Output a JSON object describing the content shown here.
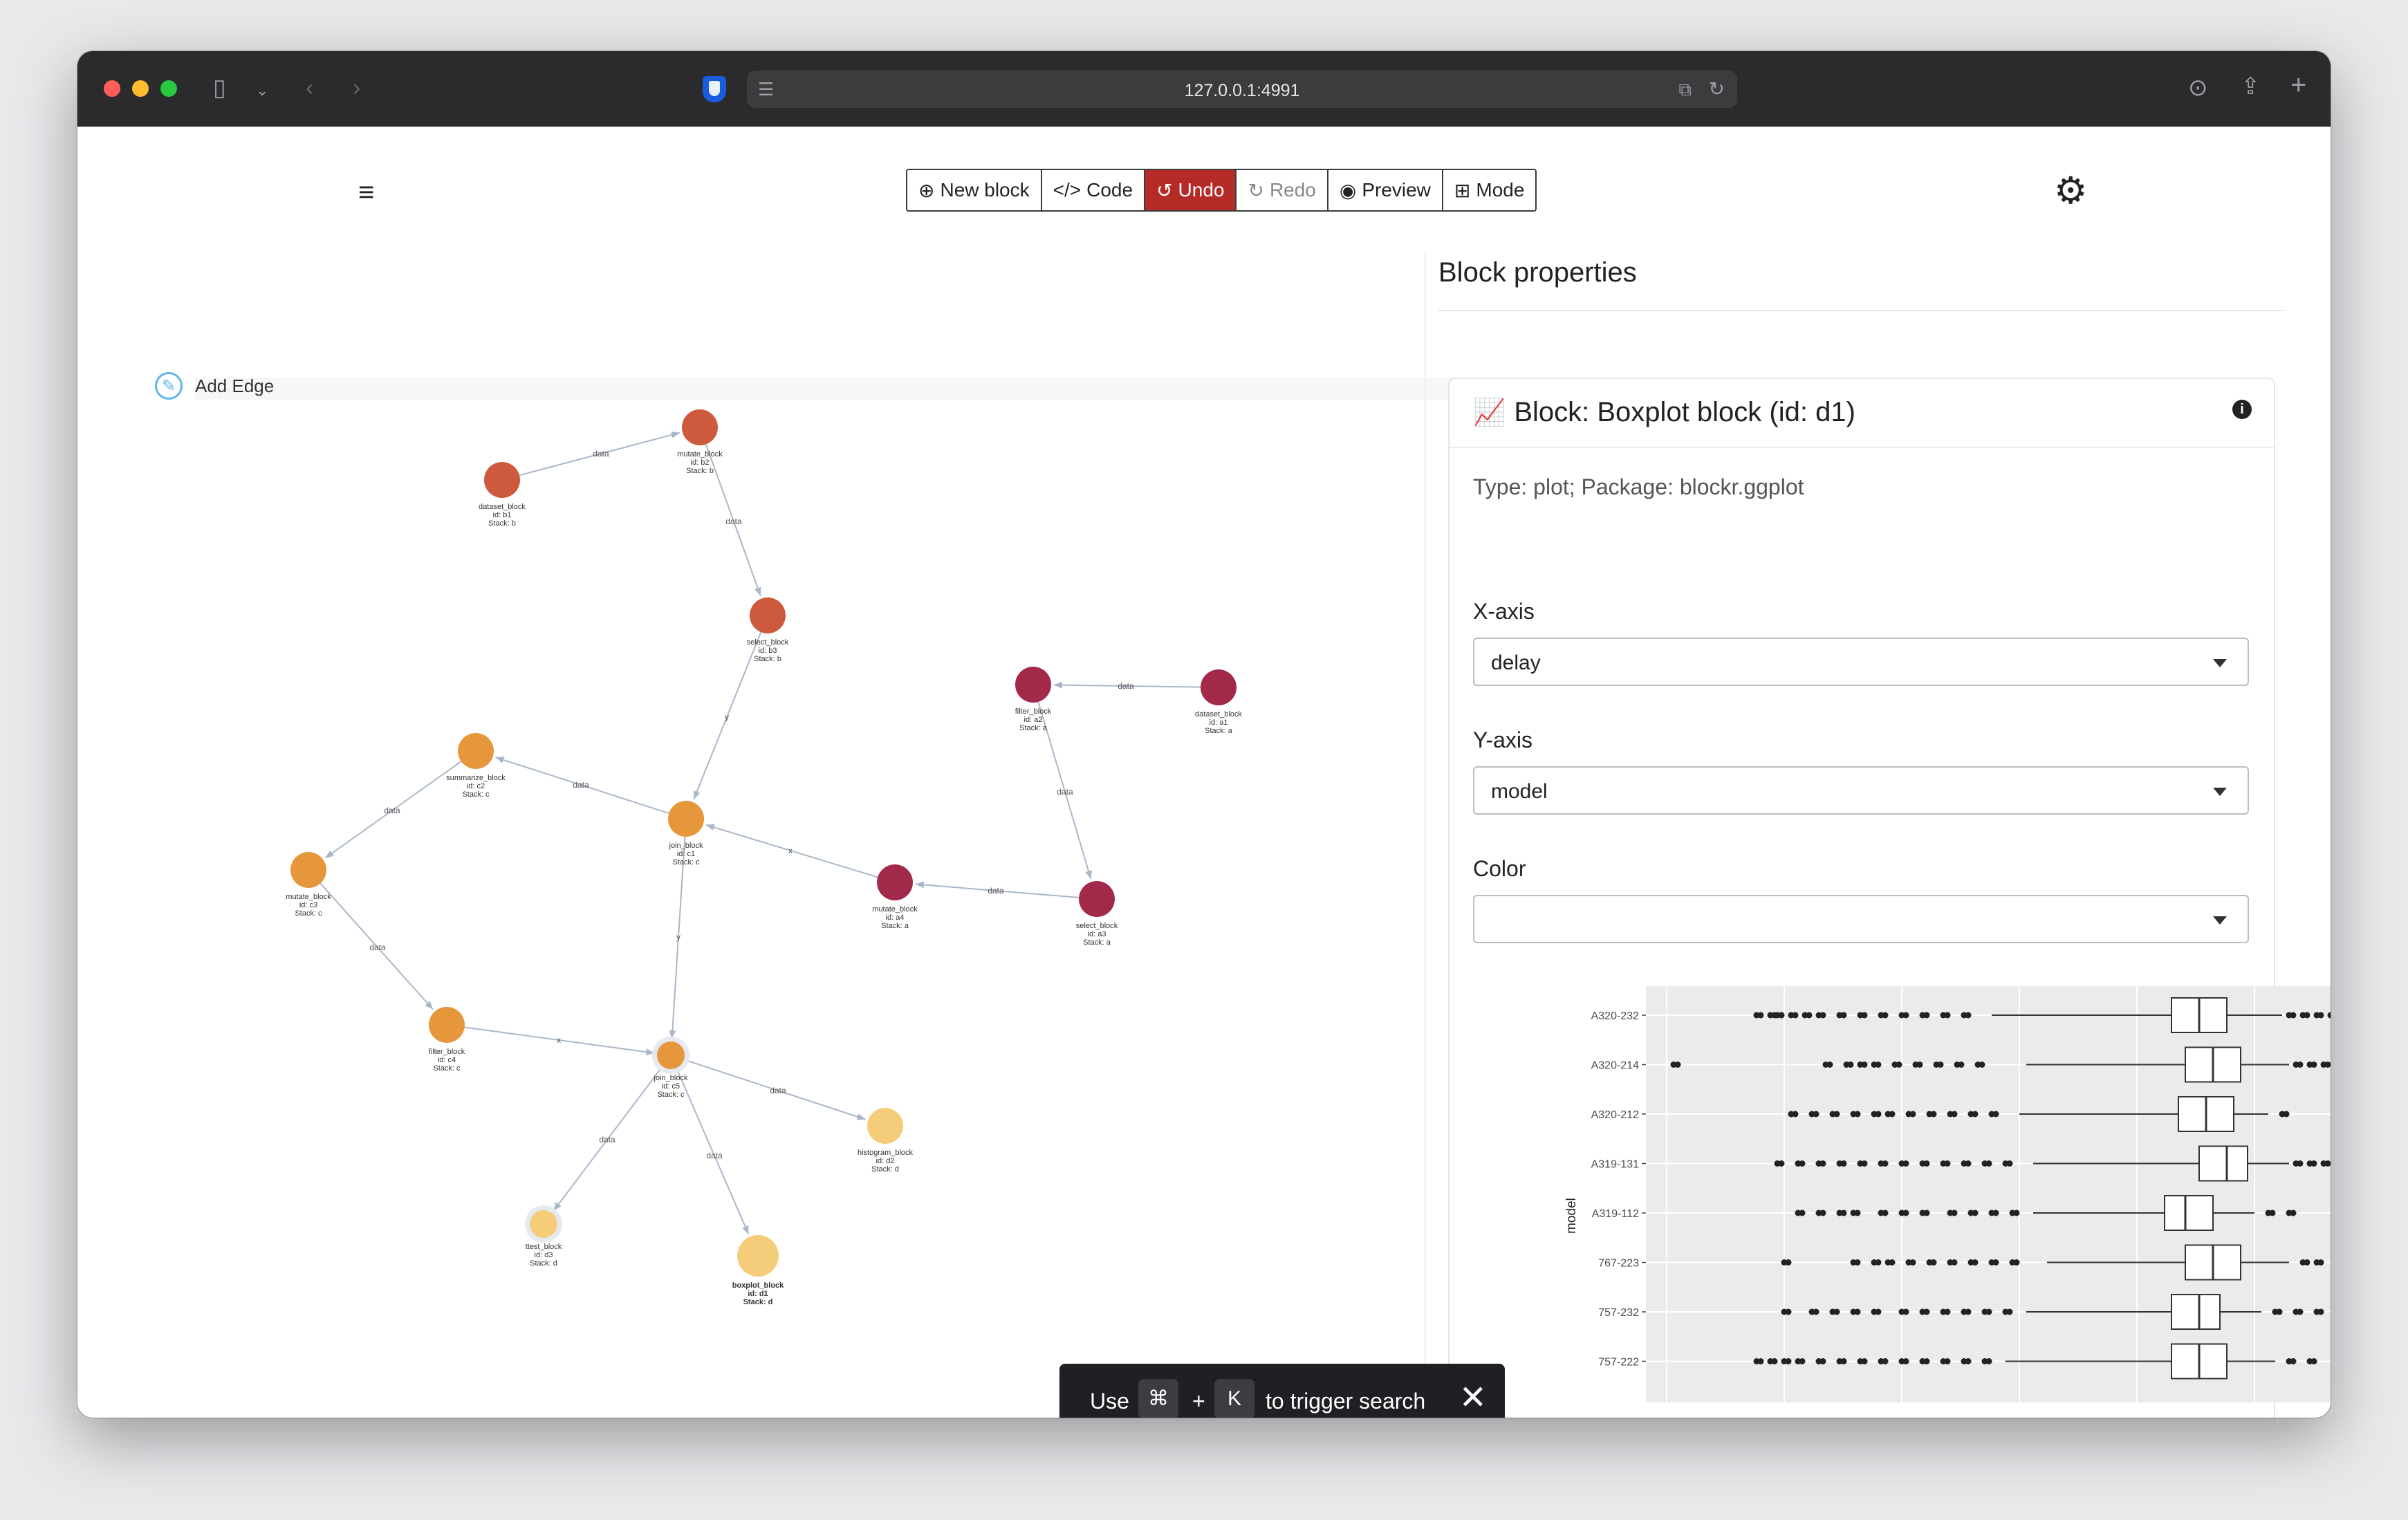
{
  "browser": {
    "url": "127.0.0.1:4991"
  },
  "toolbar": {
    "new_block": "New block",
    "code": "Code",
    "undo": "Undo",
    "redo": "Redo",
    "preview": "Preview",
    "mode": "Mode"
  },
  "graph": {
    "add_edge": "Add Edge",
    "colors": {
      "stack_a": "#a3294a",
      "stack_b": "#cd5a3c",
      "stack_c": "#e6963b",
      "stack_d": "#f5cd7a",
      "edge": "#a9b7c9"
    },
    "nodes": [
      {
        "type": "dataset_block",
        "id": "id: b1",
        "stack": "Stack: b"
      },
      {
        "type": "mutate_block",
        "id": "id: b2",
        "stack": "Stack: b"
      },
      {
        "type": "select_block",
        "id": "id: b3",
        "stack": "Stack: b"
      },
      {
        "type": "filter_block",
        "id": "id: a2",
        "stack": "Stack: a"
      },
      {
        "type": "dataset_block",
        "id": "id: a1",
        "stack": "Stack: a"
      },
      {
        "type": "summarize_block",
        "id": "id: c2",
        "stack": "Stack: c"
      },
      {
        "type": "join_block",
        "id": "id: c1",
        "stack": "Stack: c"
      },
      {
        "type": "mutate_block",
        "id": "id: c3",
        "stack": "Stack: c"
      },
      {
        "type": "mutate_block",
        "id": "id: a4",
        "stack": "Stack: a"
      },
      {
        "type": "select_block",
        "id": "id: a3",
        "stack": "Stack: a"
      },
      {
        "type": "filter_block",
        "id": "id: c4",
        "stack": "Stack: c"
      },
      {
        "type": "join_block",
        "id": "id: c5",
        "stack": "Stack: c"
      },
      {
        "type": "histogram_block",
        "id": "id: d2",
        "stack": "Stack: d"
      },
      {
        "type": "ttest_block",
        "id": "id: d3",
        "stack": "Stack: d"
      },
      {
        "type": "boxplot_block",
        "id": "id: d1",
        "stack": "Stack: d"
      }
    ],
    "edges": [
      {
        "label": "data"
      },
      {
        "label": "data"
      },
      {
        "label": "y"
      },
      {
        "label": "data"
      },
      {
        "label": "data"
      },
      {
        "label": "data"
      },
      {
        "label": "data"
      },
      {
        "label": "x"
      },
      {
        "label": "data"
      },
      {
        "label": "data"
      },
      {
        "label": "y"
      },
      {
        "label": "x"
      },
      {
        "label": "data"
      },
      {
        "label": "data"
      },
      {
        "label": "data"
      }
    ]
  },
  "panel": {
    "title": "Block properties",
    "card_title": "Block: Boxplot block (id: d1)",
    "type_line": "Type: plot; Package: blockr.ggplot",
    "x_label": "X-axis",
    "x_value": "delay",
    "y_label": "Y-axis",
    "y_value": "model",
    "color_label": "Color",
    "color_value": ""
  },
  "toast": {
    "use": "Use",
    "cmd": "⌘",
    "plus": "+",
    "key": "K",
    "rest": "to trigger search"
  },
  "chart_data": {
    "type": "boxplot",
    "ylabel": "model",
    "xlabel": "",
    "categories": [
      "A320-232",
      "A320-214",
      "A320-212",
      "A319-131",
      "A319-112",
      "767-223",
      "757-232",
      "757-222"
    ],
    "boxes": [
      {
        "q1": 0.76,
        "median": 0.8,
        "q3": 0.84,
        "wlo": 0.5,
        "whi": 0.92,
        "outliers": [
          0.16,
          0.18,
          0.19,
          0.21,
          0.23,
          0.25,
          0.28,
          0.31,
          0.34,
          0.37,
          0.4,
          0.43,
          0.46,
          0.93,
          0.95,
          0.97,
          0.99
        ]
      },
      {
        "q1": 0.78,
        "median": 0.82,
        "q3": 0.86,
        "wlo": 0.55,
        "whi": 0.93,
        "outliers": [
          0.04,
          0.26,
          0.29,
          0.31,
          0.33,
          0.36,
          0.39,
          0.42,
          0.45,
          0.48,
          0.94,
          0.96,
          0.98
        ]
      },
      {
        "q1": 0.77,
        "median": 0.81,
        "q3": 0.85,
        "wlo": 0.54,
        "whi": 0.9,
        "outliers": [
          0.21,
          0.24,
          0.27,
          0.3,
          0.33,
          0.35,
          0.38,
          0.41,
          0.44,
          0.47,
          0.5,
          0.92
        ]
      },
      {
        "q1": 0.8,
        "median": 0.84,
        "q3": 0.87,
        "wlo": 0.56,
        "whi": 0.93,
        "outliers": [
          0.19,
          0.22,
          0.25,
          0.28,
          0.31,
          0.34,
          0.37,
          0.4,
          0.43,
          0.46,
          0.49,
          0.52,
          0.94,
          0.96,
          0.98,
          1.0
        ]
      },
      {
        "q1": 0.75,
        "median": 0.78,
        "q3": 0.82,
        "wlo": 0.56,
        "whi": 0.88,
        "outliers": [
          0.22,
          0.25,
          0.28,
          0.3,
          0.34,
          0.37,
          0.4,
          0.44,
          0.47,
          0.5,
          0.53,
          0.9,
          0.93
        ]
      },
      {
        "q1": 0.78,
        "median": 0.82,
        "q3": 0.86,
        "wlo": 0.58,
        "whi": 0.93,
        "outliers": [
          0.2,
          0.3,
          0.33,
          0.35,
          0.38,
          0.41,
          0.44,
          0.47,
          0.5,
          0.53,
          0.95,
          0.97
        ]
      },
      {
        "q1": 0.76,
        "median": 0.8,
        "q3": 0.83,
        "wlo": 0.55,
        "whi": 0.89,
        "outliers": [
          0.2,
          0.24,
          0.27,
          0.3,
          0.33,
          0.37,
          0.4,
          0.43,
          0.46,
          0.49,
          0.52,
          0.91,
          0.94,
          0.97
        ]
      },
      {
        "q1": 0.76,
        "median": 0.8,
        "q3": 0.84,
        "wlo": 0.52,
        "whi": 0.91,
        "outliers": [
          0.16,
          0.18,
          0.2,
          0.22,
          0.25,
          0.28,
          0.31,
          0.34,
          0.37,
          0.4,
          0.43,
          0.46,
          0.49,
          0.93,
          0.96
        ]
      }
    ]
  }
}
